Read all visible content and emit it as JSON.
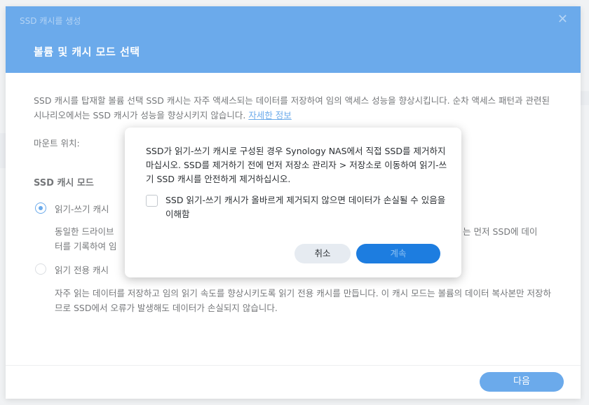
{
  "window": {
    "title": "SSD 캐시를 생성",
    "close_icon": "close-icon"
  },
  "page": {
    "heading": "볼륨 및 캐시 모드 선택",
    "description": "SSD 캐시를 탑재할 볼륨 선택 SSD 캐시는 자주 액세스되는 데이터를 저장하여 임의 액세스 성능을 향상시킵니다. 순차 액세스 패턴과 관련된 시나리오에서는 SSD 캐시가 성능을 향상시키지 않습니다.",
    "learn_more_link": "자세한 정보",
    "mount_label": "마운트 위치:",
    "mode_heading": "SSD 캐시 모드",
    "modes": [
      {
        "label": "읽기-쓰기 캐시",
        "checked": true,
        "desc_line1_left": "동일한 드라이브",
        "desc_line1_right": "는 먼저 SSD에 데이",
        "desc_line2_left": "터를 기록하여 임"
      },
      {
        "label": "읽기 전용 캐시",
        "checked": false,
        "desc": "자주 읽는 데이터를 저장하고 임의 읽기 속도를 향상시키도록 읽기 전용 캐시를 만듭니다. 이 캐시 모드는 볼륨의 데이터 복사본만 저장하므로 SSD에서 오류가 발생해도 데이터가 손실되지 않습니다."
      }
    ],
    "next_button": "다음"
  },
  "modal": {
    "message": "SSD가 읽기-쓰기 캐시로 구성된 경우 Synology NAS에서 직접 SSD를 제거하지 마십시오. SSD를 제거하기 전에 먼저 저장소 관리자 > 저장소로 이동하여 읽기-쓰기 SSD 캐시를 안전하게 제거하십시오.",
    "checkbox_label": "SSD 읽기-쓰기 캐시가 올바르게 제거되지 않으면 데이터가 손실될 수 있음을 이해함",
    "checkbox_checked": false,
    "cancel_button": "취소",
    "continue_button": "계속"
  },
  "colors": {
    "accent": "#1d7de0",
    "header_bg": "#1d7de0",
    "secondary_button_bg": "#e6ebf1"
  }
}
